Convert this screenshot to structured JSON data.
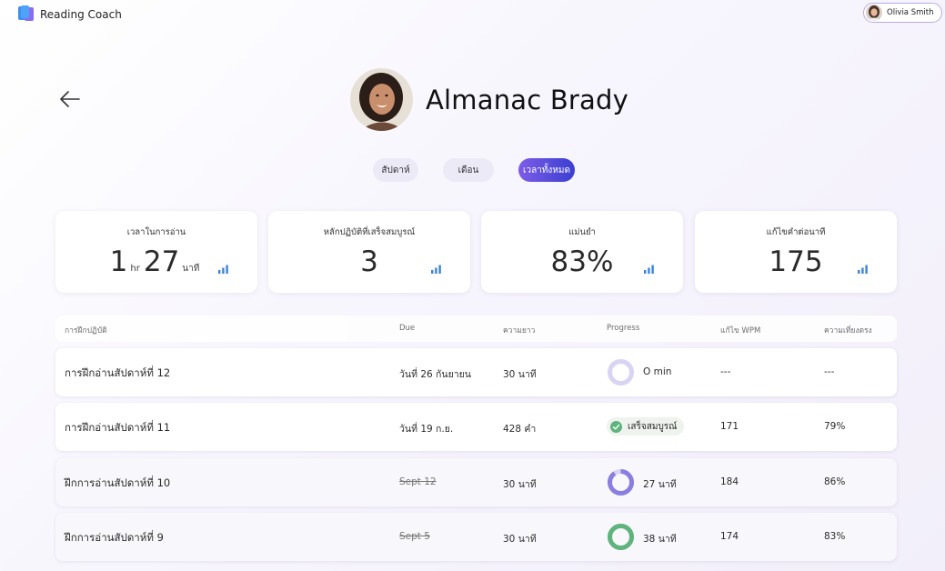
{
  "app": {
    "title": "Reading Coach",
    "logo_icon": "book-stack-icon",
    "accent": "#5b4fd6"
  },
  "user": {
    "name": "Olivia Smith"
  },
  "student": {
    "name": "Almanac Brady"
  },
  "tabs": [
    {
      "label": "สัปดาห์",
      "active": false
    },
    {
      "label": "เดือน",
      "active": false
    },
    {
      "label": "เวลาทั้งหมด",
      "active": true
    }
  ],
  "stats": [
    {
      "label": "เวลาในการอ่าน",
      "value_hours": "1",
      "hours_unit": "hr",
      "value_minutes": "27",
      "minutes_unit": "นาที"
    },
    {
      "label": "หลักปฏิบัติที่เสร็จสมบูรณ์",
      "value": "3"
    },
    {
      "label": "แม่นยำ",
      "value": "83%"
    },
    {
      "label": "แก้ไขคำต่อนาที",
      "value": "175"
    }
  ],
  "table": {
    "headers": [
      "การฝึกปฏิบัติ",
      "Due",
      "ความยาว",
      "Progress",
      "แก้ไข WPM",
      "ความเที่ยงตรง"
    ],
    "rows": [
      {
        "name": "การฝึกอ่านสัปดาห์ที่ 12",
        "due": "วันที่ 26 กันยายน",
        "due_past": false,
        "length": "30 นาที",
        "progress_text": "O min",
        "progress_fraction": 0,
        "progress_color": "#8a7fe0",
        "wpm": "---",
        "accuracy": "---"
      },
      {
        "name": "การฝึกอ่านสัปดาห์ที่ 11",
        "due": "วันที่ 19 ก.ย.",
        "due_past": false,
        "length": "428 คำ",
        "status": "เสร็จสมบูรณ์",
        "status_color": "#5fb37c",
        "wpm": "171",
        "accuracy": "79%"
      },
      {
        "name": "ฝึกการอ่านสัปดาห์ที่ 10",
        "due": "Sept 12",
        "due_past": true,
        "length": "30 นาที",
        "progress_text": "27 นาที",
        "progress_fraction": 0.9,
        "progress_color": "#8a7fe0",
        "wpm": "184",
        "accuracy": "86%"
      },
      {
        "name": "ฝึกการอ่านสัปดาห์ที่ 9",
        "due": "Sept 5",
        "due_past": true,
        "length": "30 นาที",
        "progress_text": "38 นาที",
        "progress_fraction": 1,
        "progress_color": "#5fb37c",
        "wpm": "174",
        "accuracy": "83%"
      }
    ]
  }
}
